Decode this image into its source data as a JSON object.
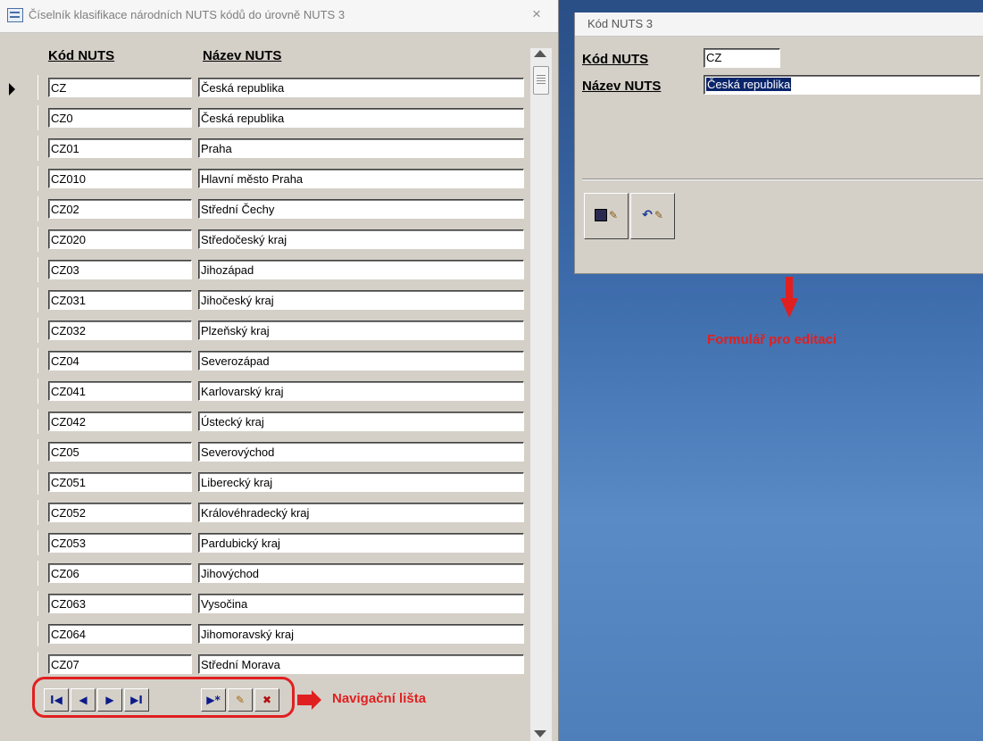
{
  "list_window": {
    "title": "Číselník klasifikace národních NUTS kódů do úrovně NUTS 3",
    "close_glyph": "×",
    "headers": {
      "code": "Kód NUTS",
      "name": "Název NUTS"
    },
    "current_row_index": 0,
    "rows": [
      {
        "code": "CZ",
        "name": "Česká republika"
      },
      {
        "code": "CZ0",
        "name": "Česká republika"
      },
      {
        "code": "CZ01",
        "name": "Praha"
      },
      {
        "code": "CZ010",
        "name": "Hlavní město Praha"
      },
      {
        "code": "CZ02",
        "name": "Střední Čechy"
      },
      {
        "code": "CZ020",
        "name": "Středočeský kraj"
      },
      {
        "code": "CZ03",
        "name": "Jihozápad"
      },
      {
        "code": "CZ031",
        "name": "Jihočeský kraj"
      },
      {
        "code": "CZ032",
        "name": "Plzeňský kraj"
      },
      {
        "code": "CZ04",
        "name": "Severozápad"
      },
      {
        "code": "CZ041",
        "name": "Karlovarský kraj"
      },
      {
        "code": "CZ042",
        "name": "Ústecký kraj"
      },
      {
        "code": "CZ05",
        "name": "Severovýchod"
      },
      {
        "code": "CZ051",
        "name": "Liberecký kraj"
      },
      {
        "code": "CZ052",
        "name": "Královéhradecký kraj"
      },
      {
        "code": "CZ053",
        "name": "Pardubický kraj"
      },
      {
        "code": "CZ06",
        "name": "Jihovýchod"
      },
      {
        "code": "CZ063",
        "name": "Vysočina"
      },
      {
        "code": "CZ064",
        "name": "Jihomoravský kraj"
      },
      {
        "code": "CZ07",
        "name": "Střední Morava"
      }
    ],
    "navbar": {
      "first_glyph": "I◀",
      "prev_glyph": "◀",
      "next_glyph": "▶",
      "last_glyph": "▶I",
      "new_glyph": "▶*",
      "edit_glyph": "✎",
      "delete_glyph": "✖"
    }
  },
  "annotations": {
    "navbar_label": "Navigační lišta",
    "form_label": "Formulář pro editaci",
    "color": "#e02020"
  },
  "form_window": {
    "title": "Kód NUTS 3",
    "code_label": "Kód NUTS",
    "name_label": "Název NUTS",
    "code_value": "CZ",
    "name_value": "Česká republika",
    "pencil_glyph": "✎",
    "undo_glyph": "↶"
  },
  "icons": {
    "form_title_icon": "datasheet-icon",
    "save": "save-record-icon",
    "undo": "undo-icon"
  }
}
